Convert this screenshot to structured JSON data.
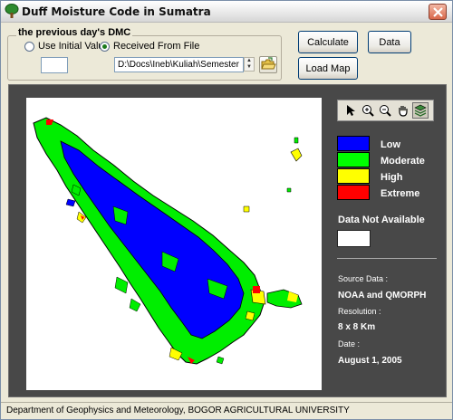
{
  "window": {
    "title": "Duff Moisture Code in Sumatra"
  },
  "dmc_group": {
    "title": "the previous day's DMC",
    "radio_initial": "Use Initial Value",
    "radio_file": "Received From File",
    "selected": "Received From File",
    "initial_value": "",
    "file_path": "D:\\Docs\\Ineb\\Kuliah\\Semester"
  },
  "buttons": {
    "calculate": "Calculate",
    "data": "Data",
    "load_map": "Load Map"
  },
  "toolbar": {
    "tools": [
      "pointer-icon",
      "zoom-in-icon",
      "zoom-out-icon",
      "pan-hand-icon",
      "layers-icon"
    ],
    "active_tool": "layers-icon"
  },
  "legend": [
    {
      "label": "Low",
      "color": "#0000ff"
    },
    {
      "label": "Moderate",
      "color": "#00ff00"
    },
    {
      "label": "High",
      "color": "#ffff00"
    },
    {
      "label": "Extreme",
      "color": "#ff0000"
    }
  ],
  "not_available": {
    "label": "Data Not Available",
    "color": "#ffffff"
  },
  "info": {
    "source_label": "Source Data :",
    "source_value": "NOAA and QMORPH",
    "resolution_label": "Resolution :",
    "resolution_value": "8 x 8 Km",
    "date_label": "Date :",
    "date_value": "August 1, 2005"
  },
  "status": {
    "text": "Department of Geophysics and Meteorology, BOGOR AGRICULTURAL UNIVERSITY"
  }
}
